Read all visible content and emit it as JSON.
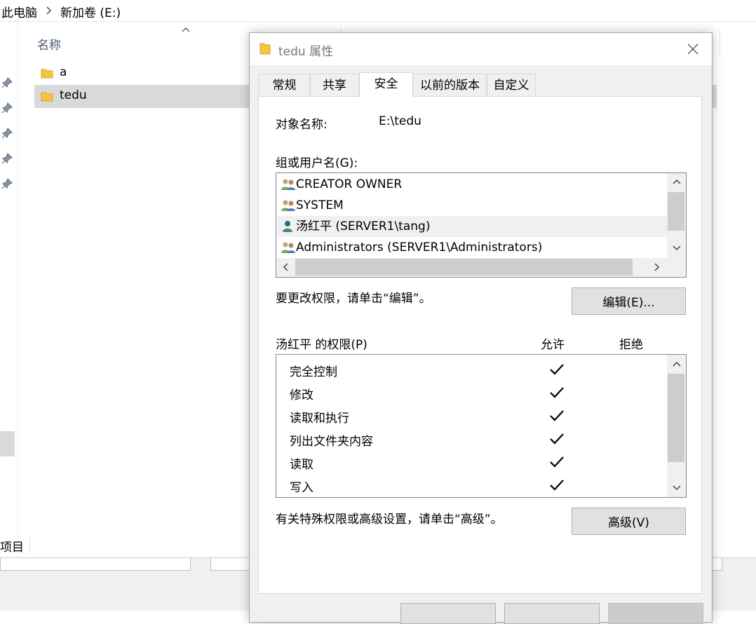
{
  "explorer": {
    "breadcrumb": [
      "此电脑",
      "新加卷 (E:)"
    ],
    "column_name": "名称",
    "files": [
      "a",
      "tedu"
    ],
    "selected_file": "tedu",
    "status": "项目"
  },
  "dialog": {
    "title": "tedu 属性",
    "tabs": [
      "常规",
      "共享",
      "安全",
      "以前的版本",
      "自定义"
    ],
    "active_tab": "安全",
    "object_name_label": "对象名称:",
    "object_name_value": "E:\\tedu",
    "groups_label": "组或用户名(G):",
    "users": [
      {
        "name": "CREATOR OWNER",
        "icon": "group-users-icon"
      },
      {
        "name": "SYSTEM",
        "icon": "group-users-icon"
      },
      {
        "name": "汤红平 (SERVER1\\tang)",
        "icon": "single-user-icon"
      },
      {
        "name": "Administrators (SERVER1\\Administrators)",
        "icon": "group-users-icon"
      }
    ],
    "change_hint": "要更改权限，请单击“编辑”。",
    "edit_button": "编辑(E)...",
    "permissions_label": "汤红平 的权限(P)",
    "allow_header": "允许",
    "deny_header": "拒绝",
    "permissions": [
      {
        "name": "完全控制",
        "allow": true,
        "deny": false
      },
      {
        "name": "修改",
        "allow": true,
        "deny": false
      },
      {
        "name": "读取和执行",
        "allow": true,
        "deny": false
      },
      {
        "name": "列出文件夹内容",
        "allow": true,
        "deny": false
      },
      {
        "name": "读取",
        "allow": true,
        "deny": false
      },
      {
        "name": "写入",
        "allow": true,
        "deny": false
      }
    ],
    "advanced_hint": "有关特殊权限或高级设置，请单击“高级”。",
    "advanced_button": "高级(V)"
  },
  "colors": {
    "selection": "#d9d9d9",
    "folder": "#f6c343",
    "dialog_bg": "#f0f0f0",
    "border": "#828790"
  }
}
